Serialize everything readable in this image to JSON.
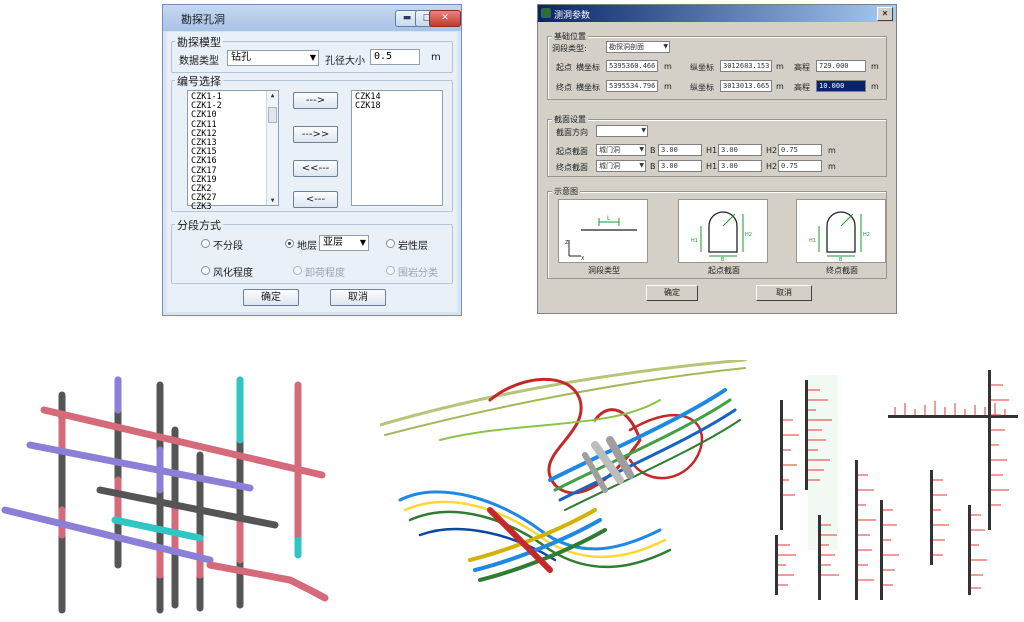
{
  "dialog1": {
    "title": "勘探孔洞",
    "model_group": "勘探模型",
    "data_type_label": "数据类型",
    "data_type_value": "钻孔",
    "hole_size_label": "孔径大小",
    "hole_size_value": "0.5",
    "unit": "m",
    "select_group": "编号选择",
    "available_list": [
      "CZK1-1",
      "CZK1-2",
      "CZK10",
      "CZK11",
      "CZK12",
      "CZK13",
      "CZK15",
      "CZK16",
      "CZK17",
      "CZK19",
      "CZK2",
      "CZK27",
      "CZK3"
    ],
    "selected_list": [
      "CZK14",
      "CZK18"
    ],
    "btn_add": "--->",
    "btn_add_all": "--->>",
    "btn_remove_all": "<<---",
    "btn_remove": "<---",
    "segment_group": "分段方式",
    "opt_none": "不分段",
    "opt_stratum": "地层",
    "stratum_value": "亚层",
    "opt_lithology": "岩性层",
    "opt_weathering": "风化程度",
    "opt_unloading": "卸荷程度",
    "opt_rock_class": "围岩分类",
    "ok": "确定",
    "cancel": "取消"
  },
  "dialog2": {
    "title": "测洞参数",
    "base_group": "基础位置",
    "tunnel_type_label": "洞段类型:",
    "tunnel_type_value": "勘探洞剖面",
    "start_label": "起点",
    "end_label": "终点",
    "start_x_label": "横坐标",
    "start_x": "5395360.466",
    "start_y_label": "纵坐标",
    "start_y": "3012683.153",
    "start_z_label": "高程",
    "start_z": "729.000",
    "end_x_label": "横坐标",
    "end_x": "5395534.796",
    "end_y_label": "纵坐标",
    "end_y": "3013013.665",
    "end_z_label": "高程",
    "end_z": "10.000",
    "unit": "m",
    "section_group": "截面设置",
    "section_dir_label": "截面方向",
    "start_section_label": "起点截面",
    "end_section_label": "终点截面",
    "start_section_type": "城门洞",
    "end_section_type": "城门洞",
    "b_label": "B",
    "h1_label": "H1",
    "h2_label": "H2",
    "start_b": "3.00",
    "start_h1": "3.00",
    "start_h2": "0.75",
    "end_b": "3.00",
    "end_h1": "3.00",
    "end_h2": "0.75",
    "preview_group": "示意图",
    "cap_type": "洞段类型",
    "cap_start": "起点截面",
    "cap_end": "终点截面",
    "ok": "确定",
    "cancel": "取消"
  }
}
